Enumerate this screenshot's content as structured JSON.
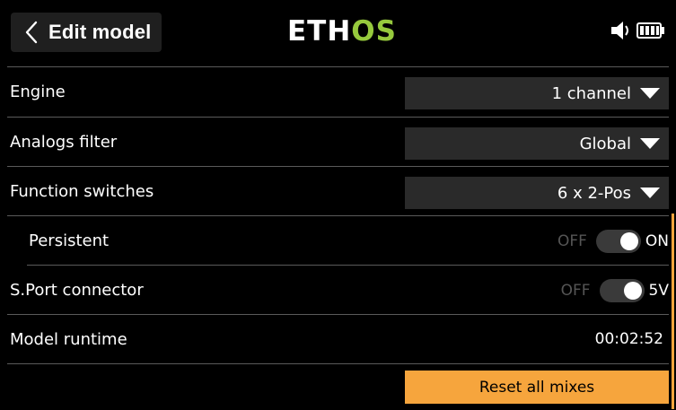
{
  "header": {
    "title": "Edit model",
    "logo_primary": "ETH",
    "logo_accent": "OS",
    "logo_accent_color": "#96c93d",
    "status_icons": [
      "speaker-icon",
      "battery-icon"
    ]
  },
  "settings": {
    "engine": {
      "label": "Engine",
      "value": "1 channel"
    },
    "analogs_filter": {
      "label": "Analogs filter",
      "value": "Global"
    },
    "function_switches": {
      "label": "Function switches",
      "value": "6 x 2-Pos"
    },
    "persistent": {
      "label": "Persistent",
      "off_label": "OFF",
      "on_label": "ON",
      "state": "on"
    },
    "sport_connector": {
      "label": "S.Port connector",
      "off_label": "OFF",
      "on_label": "5V",
      "state": "on"
    },
    "model_runtime": {
      "label": "Model runtime",
      "value": "00:02:52"
    }
  },
  "actions": {
    "reset_label": "Reset all mixes"
  },
  "colors": {
    "accent": "#f6a53d",
    "background": "#000000",
    "dropdown_bg": "#2a2a2a"
  }
}
